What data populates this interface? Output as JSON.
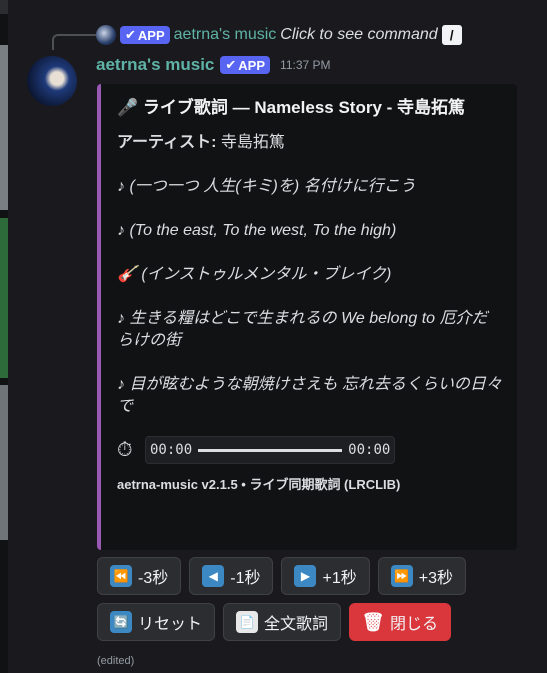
{
  "reply": {
    "badge": "APP",
    "name": "aetrna's music",
    "text": "Click to see command",
    "cmd_icon": "/"
  },
  "message": {
    "author": "aetrna's music",
    "badge": "APP",
    "time": "11:37 PM",
    "edited": "(edited)"
  },
  "embed": {
    "accent_color": "#9b59b6",
    "title": "🎤 ライブ歌詞 — Nameless Story - 寺島拓篤",
    "artist_label": "アーティスト:",
    "artist_value": " 寺島拓篤",
    "lyrics": [
      "♪ (一つ一つ 人生(キミ)を) 名付けに行こう",
      "♪ (To the east, To the west, To the high)",
      "🎸 (インストゥルメンタル・ブレイク)",
      "♪ 生きる糧はどこで生まれるの We belong to 厄介だらけの街",
      "♪ 目が眩むような朝焼けさえも 忘れ去るくらいの日々で"
    ],
    "player": {
      "icon": "⏱",
      "current": "00:00",
      "total": "00:00",
      "progress": 0
    },
    "footer": "aetrna-music v2.1.5 • ライブ同期歌詞 (LRCLIB)"
  },
  "buttons": {
    "row1": [
      {
        "icon": "⏪",
        "label": "-3秒"
      },
      {
        "icon": "◀",
        "label": "-1秒"
      },
      {
        "icon": "▶",
        "label": "+1秒"
      },
      {
        "icon": "⏩",
        "label": "+3秒"
      }
    ],
    "row2": [
      {
        "icon": "🔄",
        "label": "リセット"
      },
      {
        "icon": "📄",
        "label": "全文歌詞"
      },
      {
        "icon": "🗑",
        "label": "閉じる"
      }
    ]
  },
  "colors": {
    "brand_badge": "#5865f2",
    "author": "#5fb3a6",
    "danger": "#da373c"
  }
}
